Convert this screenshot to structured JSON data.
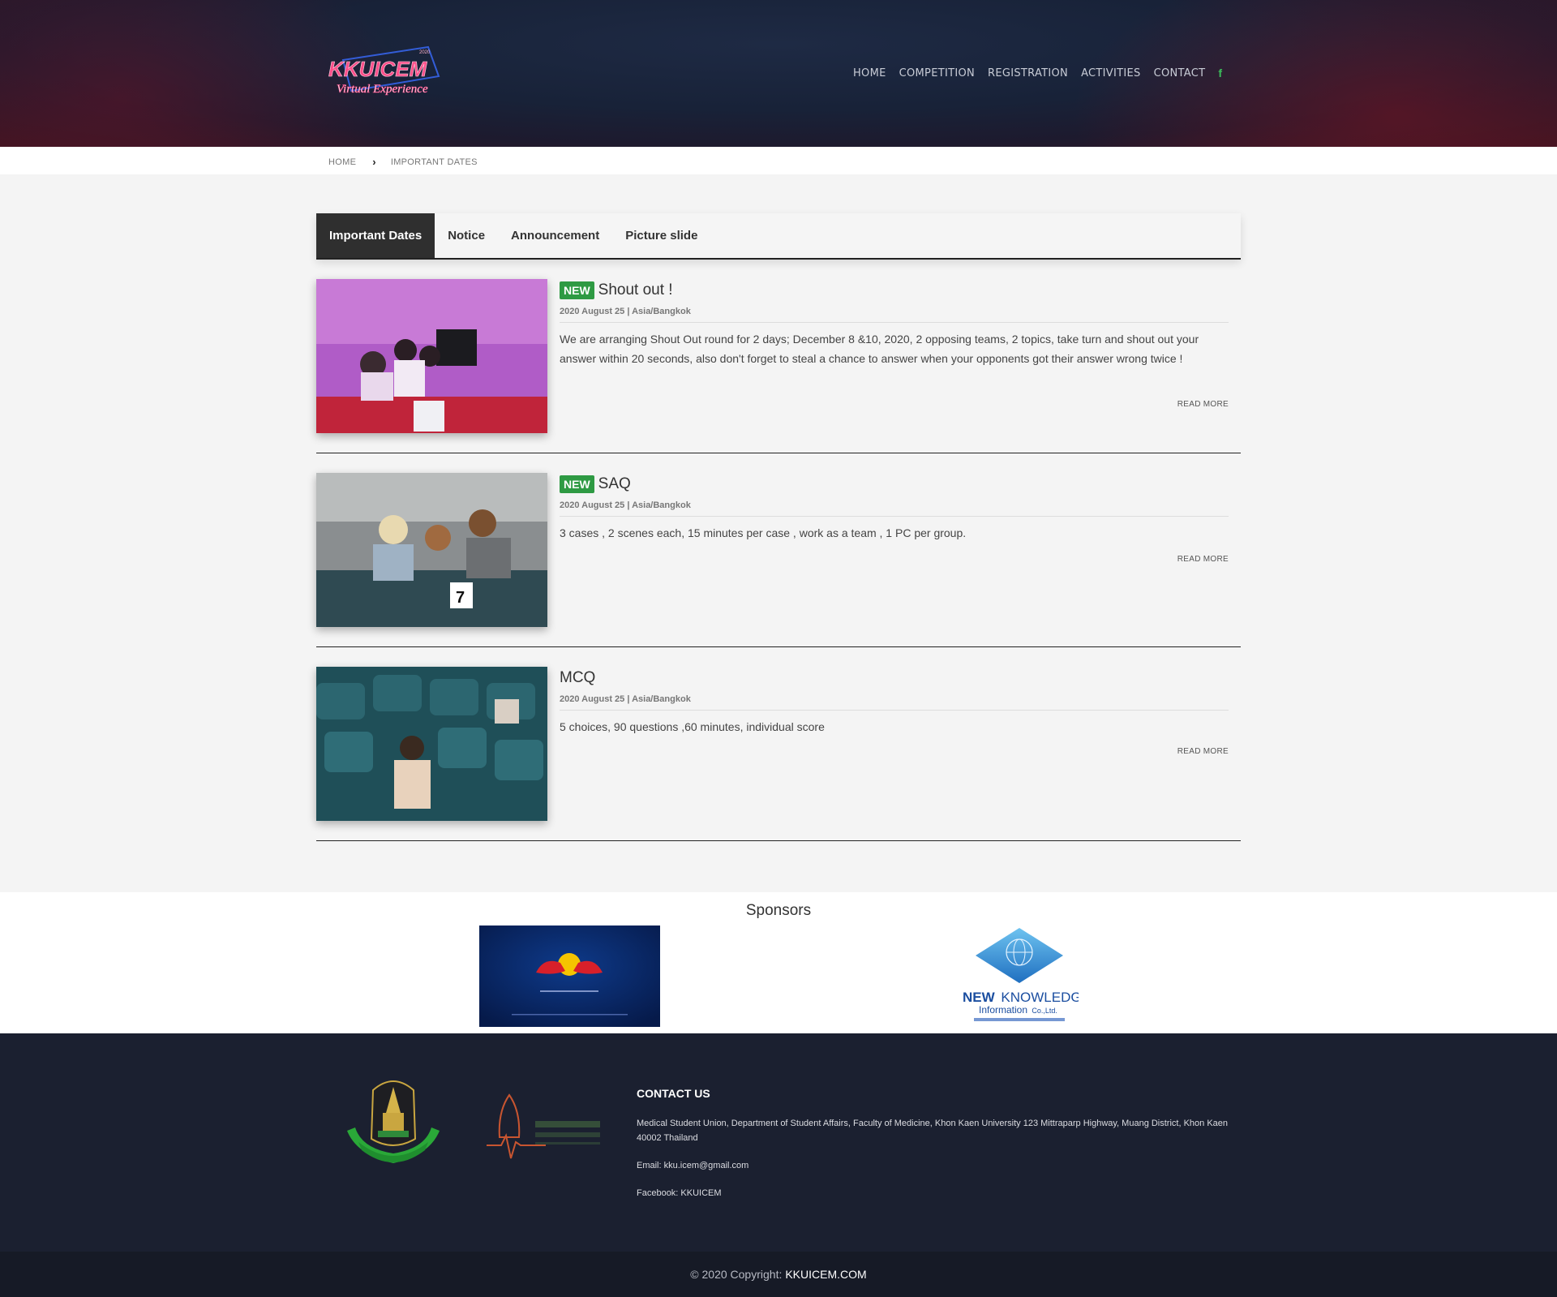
{
  "header": {
    "nav": [
      "HOME",
      "COMPETITION",
      "REGISTRATION",
      "ACTIVITIES",
      "CONTACT"
    ],
    "facebook_icon": "f"
  },
  "breadcrumb": {
    "home": "HOME",
    "current": "IMPORTANT DATES"
  },
  "tabs": [
    "Important Dates",
    "Notice",
    "Announcement",
    "Picture slide"
  ],
  "posts": [
    {
      "badge": "NEW",
      "title": "Shout out !",
      "meta": "2020 August 25 | Asia/Bangkok",
      "desc": "We are arranging Shout Out round for 2 days; December 8 &10, 2020, 2 opposing teams, 2 topics, take turn and shout out  your answer  within 20 seconds, also don't forget to steal a chance to answer when your opponents got their answer wrong twice !",
      "readmore": "READ MORE"
    },
    {
      "badge": "NEW",
      "title": "SAQ",
      "meta": "2020 August 25 | Asia/Bangkok",
      "desc": "3 cases , 2 scenes each, 15 minutes per case , work as a team , 1 PC per group.",
      "readmore": "READ MORE"
    },
    {
      "title": "MCQ",
      "meta": "2020 August 25 | Asia/Bangkok",
      "desc": "5 choices, 90 questions ,60 minutes, individual score",
      "readmore": "READ MORE"
    }
  ],
  "sponsors": {
    "title": "Sponsors",
    "newknowledge": {
      "line1_bold": "NEW",
      "line1": "KNOWLEDGE",
      "line2": "Information",
      "line2_small": "Co.,Ltd."
    }
  },
  "footer": {
    "contact_title": "CONTACT US",
    "address": "Medical Student Union, Department of Student Affairs, Faculty of Medicine, Khon Kaen University 123 Mittraparp Highway, Muang District, Khon Kaen 40002 Thailand",
    "email": "Email: kku.icem@gmail.com",
    "facebook": "Facebook: KKUICEM"
  },
  "copyright": {
    "text": "© 2020 Copyright:",
    "brand": "KKUICEM.COM"
  },
  "logo": {
    "main": "KKUICEM",
    "sub": "Virtual Experience",
    "year": "2020"
  },
  "colors": {
    "badge": "#2e9a43",
    "active_tab": "#2f2f2f",
    "footer": "#1b2030",
    "facebook": "#3bbd5a"
  }
}
